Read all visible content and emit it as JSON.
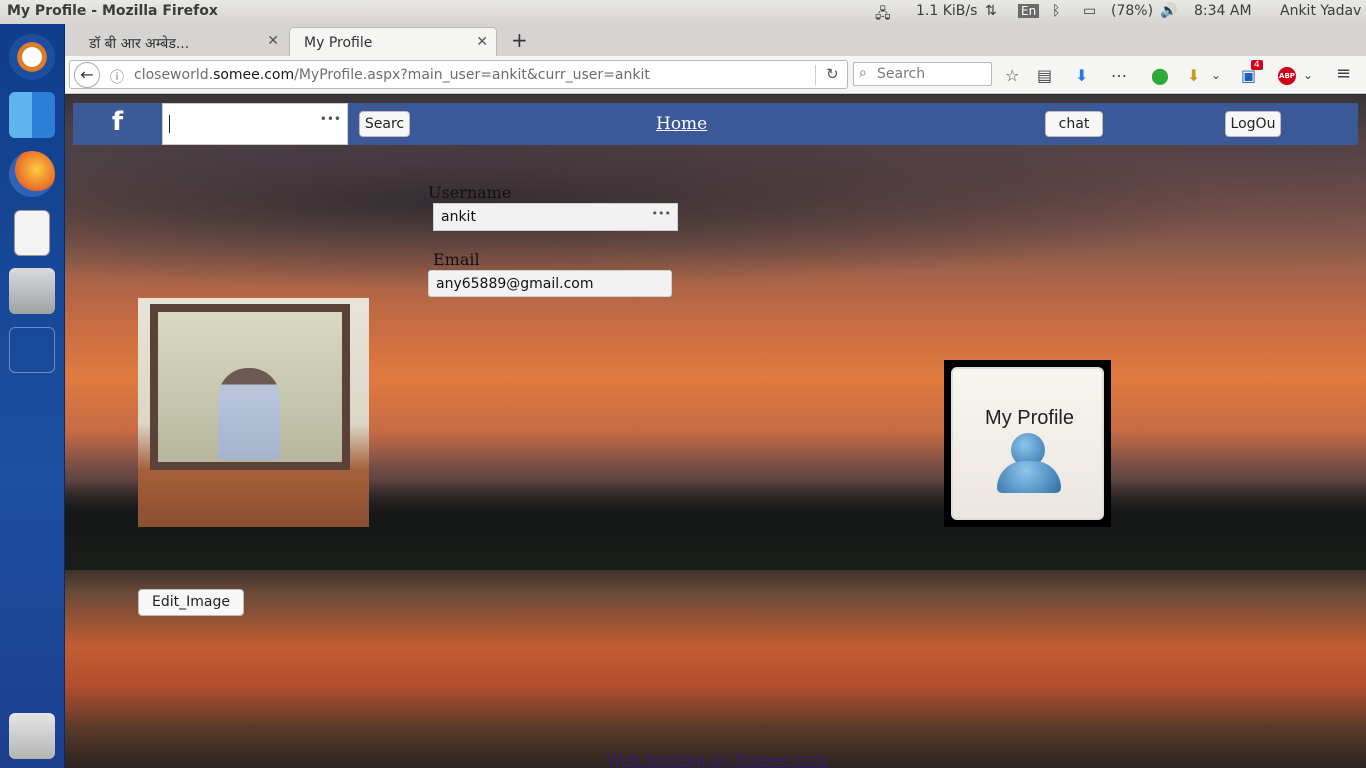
{
  "system": {
    "window_title": "My Profile - Mozilla Firefox",
    "net_speed": "1.1 KiB/s",
    "keyboard": "En",
    "battery": "(78%)",
    "time": "8:34 AM",
    "user": "Ankit Yadav"
  },
  "browser": {
    "tabs": [
      {
        "label": "डॉ बी आर अम्बेड..."
      },
      {
        "label": "My Profile"
      }
    ],
    "new_tab": "+",
    "url_domain": "closeworld.somee.com",
    "url_prefix": "closeworld.",
    "url_host": "somee.com",
    "url_path": "/MyProfile.aspx?main_user=ankit&curr_user=ankit",
    "search_placeholder": "Search",
    "ext_badge": "4",
    "abp": "ABP"
  },
  "site": {
    "logo": "f",
    "search_button": "Searc",
    "home_link": "Home",
    "chat_button": "chat",
    "logout_button": "LogOu",
    "username_label": "Username",
    "username_value": "ankit",
    "email_label": "Email",
    "email_value": "any65889@gmail.com",
    "edit_image_button": "Edit_Image",
    "profile_badge_title": "My Profile",
    "footer_link": "Web hosting by Somee.com"
  }
}
